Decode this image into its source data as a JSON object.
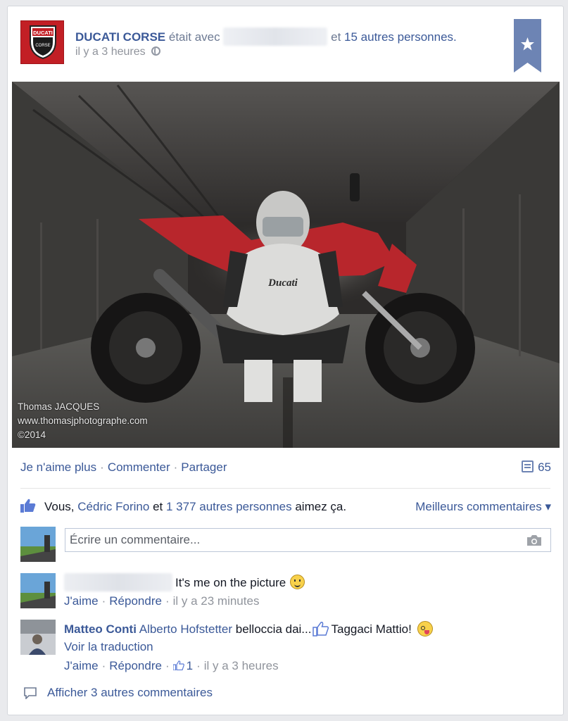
{
  "post": {
    "page_name": "DUCATI CORSE",
    "with_text": "était avec",
    "and_text": "et",
    "others_link": "15 autres personnes.",
    "timestamp": "il y a 3 heures",
    "logo_text": "DUCATI",
    "logo_subtext": "CORSE"
  },
  "photo": {
    "credit_name": "Thomas JACQUES",
    "credit_site": "www.thomasjphotographe.com",
    "credit_year": "©2014",
    "suit_text": "Ducati"
  },
  "actions": {
    "unlike": "Je n'aime plus",
    "comment": "Commenter",
    "share": "Partager",
    "separator": "·",
    "comment_count": "65"
  },
  "likes": {
    "you": "Vous,",
    "friend": "Cédric Forino",
    "and": "et",
    "others": "1 377 autres personnes",
    "suffix": "aimez ça.",
    "sort_label": "Meilleurs commentaires ▾"
  },
  "composer": {
    "placeholder": "Écrire un commentaire..."
  },
  "comments": [
    {
      "text": "It's me on the picture",
      "like": "J'aime",
      "reply": "Répondre",
      "time": "il y a 23 minutes"
    },
    {
      "author": "Matteo Conti",
      "tagged": "Alberto Hofstetter",
      "text_a": "belloccia dai...",
      "text_b": "Taggaci Mattio!",
      "translate": "Voir la traduction",
      "like": "J'aime",
      "reply": "Répondre",
      "like_count": "1",
      "time": "il y a 3 heures"
    }
  ],
  "more_comments": "Afficher 3 autres commentaires",
  "colors": {
    "link": "#3b5998",
    "muted": "#90949c",
    "ducati_red": "#c21f25",
    "bookmark": "#6d84b4"
  }
}
